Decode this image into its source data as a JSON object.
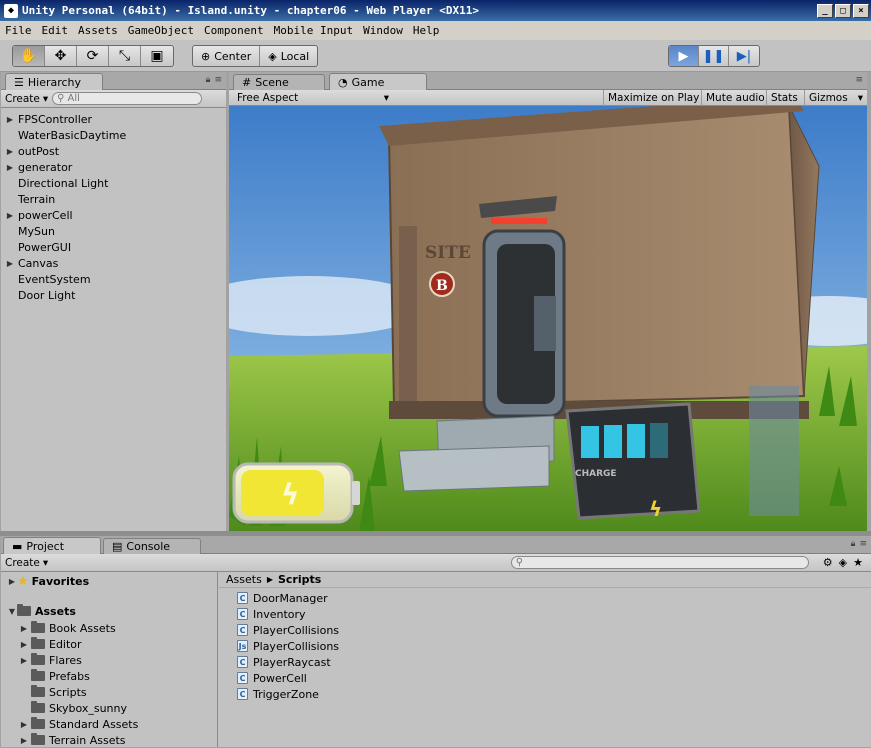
{
  "window": {
    "title": "Unity Personal (64bit) - Island.unity - chapter06 - Web Player <DX11>"
  },
  "menu": [
    "File",
    "Edit",
    "Assets",
    "GameObject",
    "Component",
    "Mobile Input",
    "Window",
    "Help"
  ],
  "toolbar": {
    "pivot": "Center",
    "space": "Local"
  },
  "hierarchy": {
    "tab": "Hierarchy",
    "create": "Create",
    "search_placeholder": "All",
    "items": [
      {
        "label": "FPSController",
        "expandable": true
      },
      {
        "label": "WaterBasicDaytime",
        "expandable": false
      },
      {
        "label": "outPost",
        "expandable": true
      },
      {
        "label": "generator",
        "expandable": true
      },
      {
        "label": "Directional Light",
        "expandable": false
      },
      {
        "label": "Terrain",
        "expandable": false
      },
      {
        "label": "powerCell",
        "expandable": true
      },
      {
        "label": "MySun",
        "expandable": false
      },
      {
        "label": "PowerGUI",
        "expandable": false
      },
      {
        "label": "Canvas",
        "expandable": true
      },
      {
        "label": "EventSystem",
        "expandable": false
      },
      {
        "label": "Door Light",
        "expandable": false
      }
    ]
  },
  "game": {
    "tab_scene": "Scene",
    "tab_game": "Game",
    "aspect": "Free Aspect",
    "maximize": "Maximize on Play",
    "mute": "Mute audio",
    "stats": "Stats",
    "gizmos": "Gizmos",
    "sign_text": "SITE",
    "sign_letter": "B",
    "charge_label": "CHARGE",
    "charge_level": 0.75
  },
  "project": {
    "tab": "Project",
    "console_tab": "Console",
    "create": "Create",
    "favorites": "Favorites",
    "assets": "Assets",
    "folders": [
      {
        "label": "Book Assets",
        "expandable": true
      },
      {
        "label": "Editor",
        "expandable": true
      },
      {
        "label": "Flares",
        "expandable": true
      },
      {
        "label": "Prefabs",
        "expandable": false
      },
      {
        "label": "Scripts",
        "expandable": false
      },
      {
        "label": "Skybox_sunny",
        "expandable": false
      },
      {
        "label": "Standard Assets",
        "expandable": true
      },
      {
        "label": "Terrain Assets",
        "expandable": true
      }
    ],
    "breadcrumb": [
      "Assets",
      "Scripts"
    ],
    "files": [
      {
        "label": "DoorManager",
        "type": "C#"
      },
      {
        "label": "Inventory",
        "type": "C#"
      },
      {
        "label": "PlayerCollisions",
        "type": "C#"
      },
      {
        "label": "PlayerCollisions",
        "type": "JS"
      },
      {
        "label": "PlayerRaycast",
        "type": "C#"
      },
      {
        "label": "PowerCell",
        "type": "C#"
      },
      {
        "label": "TriggerZone",
        "type": "C#"
      }
    ]
  }
}
